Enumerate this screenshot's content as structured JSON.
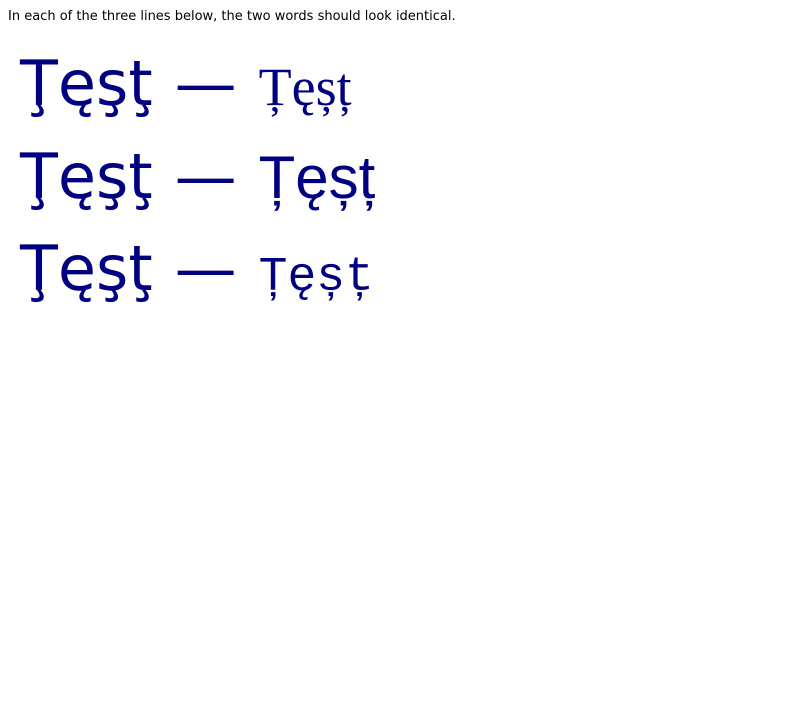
{
  "instruction": "In each of the three lines below, the two words should look identical.",
  "separator": "—",
  "lines": [
    {
      "left_word": "Ţęşţ",
      "right_word": "Țęșț"
    },
    {
      "left_word": "Ţęşţ",
      "right_word": "Țęșț"
    },
    {
      "left_word": "Ţęşţ",
      "right_word": "Țęșț"
    }
  ],
  "colors": {
    "text": "#000080",
    "instruction": "#000000",
    "background": "#ffffff"
  }
}
